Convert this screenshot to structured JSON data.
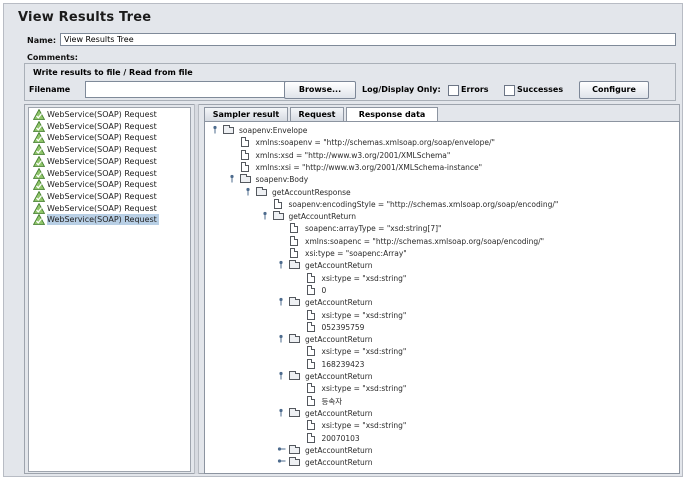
{
  "title": "View Results Tree",
  "name_label": "Name:",
  "name_value": "View Results Tree",
  "comments_label": "Comments:",
  "file_section": {
    "legend": "Write results to file / Read from file",
    "filename_label": "Filename",
    "filename_value": "",
    "browse_label": "Browse...",
    "log_display_label": "Log/Display Only:",
    "errors_label": "Errors",
    "errors_checked": false,
    "successes_label": "Successes",
    "successes_checked": false,
    "configure_label": "Configure"
  },
  "samples": [
    {
      "label": "WebService(SOAP) Request",
      "status": "ok-icon",
      "selected": false
    },
    {
      "label": "WebService(SOAP) Request",
      "status": "ok-icon",
      "selected": false
    },
    {
      "label": "WebService(SOAP) Request",
      "status": "ok-icon",
      "selected": false
    },
    {
      "label": "WebService(SOAP) Request",
      "status": "ok-icon",
      "selected": false
    },
    {
      "label": "WebService(SOAP) Request",
      "status": "ok-icon",
      "selected": false
    },
    {
      "label": "WebService(SOAP) Request",
      "status": "ok-icon",
      "selected": false
    },
    {
      "label": "WebService(SOAP) Request",
      "status": "ok-icon",
      "selected": false
    },
    {
      "label": "WebService(SOAP) Request",
      "status": "ok-icon",
      "selected": false
    },
    {
      "label": "WebService(SOAP) Request",
      "status": "ok-icon",
      "selected": false
    },
    {
      "label": "WebService(SOAP) Request",
      "status": "ok-icon",
      "selected": true
    }
  ],
  "tabs": [
    {
      "label": "Sampler result",
      "active": false
    },
    {
      "label": "Request",
      "active": false
    },
    {
      "label": "Response data",
      "active": true
    }
  ],
  "tree": [
    {
      "text": "soapenv:Envelope",
      "depth": 0,
      "kind": "folder",
      "handle": "expanded"
    },
    {
      "text": "xmlns:soapenv = \"http://schemas.xmlsoap.org/soap/envelope/\"",
      "depth": 1,
      "kind": "file"
    },
    {
      "text": "xmlns:xsd = \"http://www.w3.org/2001/XMLSchema\"",
      "depth": 1,
      "kind": "file"
    },
    {
      "text": "xmlns:xsi = \"http://www.w3.org/2001/XMLSchema-instance\"",
      "depth": 1,
      "kind": "file"
    },
    {
      "text": "soapenv:Body",
      "depth": 1,
      "kind": "folder",
      "handle": "expanded"
    },
    {
      "text": "getAccountResponse",
      "depth": 2,
      "kind": "folder",
      "handle": "expanded"
    },
    {
      "text": "soapenv:encodingStyle = \"http://schemas.xmlsoap.org/soap/encoding/\"",
      "depth": 3,
      "kind": "file"
    },
    {
      "text": "getAccountReturn",
      "depth": 3,
      "kind": "folder",
      "handle": "expanded"
    },
    {
      "text": "soapenc:arrayType = \"xsd:string[7]\"",
      "depth": 4,
      "kind": "file"
    },
    {
      "text": "xmlns:soapenc = \"http://schemas.xmlsoap.org/soap/encoding/\"",
      "depth": 4,
      "kind": "file"
    },
    {
      "text": "xsi:type = \"soapenc:Array\"",
      "depth": 4,
      "kind": "file"
    },
    {
      "text": "getAccountReturn",
      "depth": 4,
      "kind": "folder",
      "handle": "expanded"
    },
    {
      "text": "xsi:type = \"xsd:string\"",
      "depth": 5,
      "kind": "file"
    },
    {
      "text": "0",
      "depth": 5,
      "kind": "file"
    },
    {
      "text": "getAccountReturn",
      "depth": 4,
      "kind": "folder",
      "handle": "expanded"
    },
    {
      "text": "xsi:type = \"xsd:string\"",
      "depth": 5,
      "kind": "file"
    },
    {
      "text": "052395759",
      "depth": 5,
      "kind": "file"
    },
    {
      "text": "getAccountReturn",
      "depth": 4,
      "kind": "folder",
      "handle": "expanded"
    },
    {
      "text": "xsi:type = \"xsd:string\"",
      "depth": 5,
      "kind": "file"
    },
    {
      "text": "168239423",
      "depth": 5,
      "kind": "file"
    },
    {
      "text": "getAccountReturn",
      "depth": 4,
      "kind": "folder",
      "handle": "expanded"
    },
    {
      "text": "xsi:type = \"xsd:string\"",
      "depth": 5,
      "kind": "file"
    },
    {
      "text": "등속자",
      "depth": 5,
      "kind": "file"
    },
    {
      "text": "getAccountReturn",
      "depth": 4,
      "kind": "folder",
      "handle": "expanded"
    },
    {
      "text": "xsi:type = \"xsd:string\"",
      "depth": 5,
      "kind": "file"
    },
    {
      "text": "20070103",
      "depth": 5,
      "kind": "file"
    },
    {
      "text": "getAccountReturn",
      "depth": 4,
      "kind": "folder",
      "handle": "collapsed"
    },
    {
      "text": "getAccountReturn",
      "depth": 4,
      "kind": "folder",
      "handle": "collapsed"
    }
  ]
}
